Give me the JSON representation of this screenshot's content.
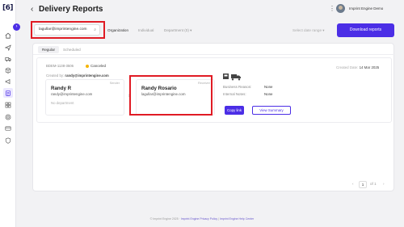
{
  "app": {
    "logo_text": "[6]"
  },
  "sidebar": {
    "collapse_icon": "chevron-right-icon",
    "items": [
      {
        "icon": "home-icon"
      },
      {
        "icon": "send-icon"
      },
      {
        "icon": "truck-icon"
      },
      {
        "icon": "package-icon"
      },
      {
        "icon": "megaphone-icon"
      },
      {
        "icon": "clipboard-icon",
        "active": true
      },
      {
        "icon": "grid-icon"
      },
      {
        "icon": "target-icon"
      },
      {
        "icon": "card-icon"
      },
      {
        "icon": "shield-icon"
      }
    ]
  },
  "header": {
    "back_icon": "‹",
    "title": "Delivery Reports",
    "kebab": "⋮",
    "user_name": "Imprint Engine Demo"
  },
  "filters": {
    "search_value": "lagullar@imprintengine.com",
    "search_icon": "⌕",
    "tabs": [
      "Organization",
      "Individual",
      "Department (0) ▾"
    ],
    "date_select": "Select date range ▾",
    "download_label": "Download reports"
  },
  "colors": {
    "accent": "#4b2ee6",
    "highlight": "#e01b24",
    "status_canceled": "#f5b400"
  },
  "report_tabs": [
    "Regular",
    "Scheduled"
  ],
  "report": {
    "id": "BDEM-1138-3506",
    "status": "Canceled",
    "created_by_label": "Created by:",
    "created_by": "randy@imprintengine.com",
    "created_date_label": "Created Date:",
    "created_date": "14 Mar 2025",
    "sender": {
      "role": "Sender",
      "name": "Randy R",
      "email": "randy@imprintengine.com",
      "department": "No department"
    },
    "recipient": {
      "role": "Receiver",
      "name": "Randy Rosario",
      "email": "lagullar@imprintengine.com"
    },
    "business_reason_label": "Business Reason:",
    "business_reason": "None",
    "internal_notes_label": "Internal Notes:",
    "internal_notes": "None",
    "copy_link_label": "Copy link",
    "view_summary_label": "View Summary"
  },
  "pagination": {
    "prev": "‹",
    "current": "1",
    "of_label": "of 1",
    "next": "›"
  },
  "footer": {
    "copyright": "© Imprint Engine 2025 ·",
    "privacy": "Imprint Engine Privacy Policy",
    "sep": "|",
    "help": "Imprint Engine Help Center"
  }
}
